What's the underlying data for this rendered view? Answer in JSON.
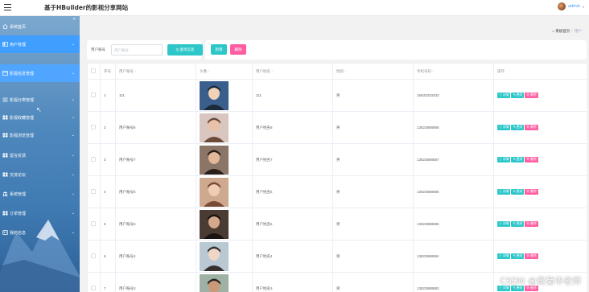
{
  "header": {
    "app_title": "基于HBuilder的影视分享网站",
    "user_name": "admin",
    "caret": "▾"
  },
  "sidebar": {
    "collapse_glyph": "«",
    "submenu_hint": "用户",
    "items": [
      {
        "label": "系统首页",
        "icon": "home-icon",
        "arrow": ""
      },
      {
        "label": "用户管理",
        "icon": "user-group-icon",
        "arrow": "⌄"
      },
      {
        "label": "影视信息管理",
        "icon": "film-icon",
        "arrow": "⌄"
      },
      {
        "label": "影视分类管理",
        "icon": "list-icon",
        "arrow": "⌄"
      },
      {
        "label": "影视收藏管理",
        "icon": "grid-icon",
        "arrow": "⌄"
      },
      {
        "label": "影视浏览管理",
        "icon": "grid-icon",
        "arrow": "⌄"
      },
      {
        "label": "留言反馈",
        "icon": "grid-icon",
        "arrow": "⌄"
      },
      {
        "label": "交流论坛",
        "icon": "grid-icon",
        "arrow": "⌄"
      },
      {
        "label": "系统管理",
        "icon": "bank-icon",
        "arrow": "⌄"
      },
      {
        "label": "订单管理",
        "icon": "grid-icon",
        "arrow": "⌄"
      },
      {
        "label": "我的信息",
        "icon": "id-card-icon",
        "arrow": "⌄"
      }
    ]
  },
  "breadcrumb": {
    "home": "系统首页",
    "separator": "/",
    "current": "用户"
  },
  "search": {
    "label": "用户账号",
    "placeholder": "用户账号",
    "button": "查询信息",
    "search_glyph": "Q"
  },
  "actions": {
    "add": "新增",
    "delete": "删除"
  },
  "table": {
    "headers": [
      "",
      "序号",
      "用户账号",
      "头像",
      "用户姓名",
      "性别",
      "手机号码",
      "操作"
    ],
    "sort_glyph": "↕",
    "op_labels": {
      "detail": "详情",
      "edit": "更改",
      "delete": "删除"
    },
    "rows": [
      {
        "index": "1",
        "account": "111",
        "name": "111",
        "gender": "男",
        "phone": "15633333333"
      },
      {
        "index": "2",
        "account": "用户账号8",
        "name": "用户姓名8",
        "gender": "男",
        "phone": "13823888888"
      },
      {
        "index": "3",
        "account": "用户账号7",
        "name": "用户姓名7",
        "gender": "男",
        "phone": "13823888887"
      },
      {
        "index": "4",
        "account": "用户账号6",
        "name": "用户姓名6",
        "gender": "男",
        "phone": "13823888886"
      },
      {
        "index": "5",
        "account": "用户账号5",
        "name": "用户姓名5",
        "gender": "男",
        "phone": "13823888885"
      },
      {
        "index": "6",
        "account": "用户账号4",
        "name": "用户姓名4",
        "gender": "男",
        "phone": "13823888884"
      },
      {
        "index": "7",
        "account": "用户账号3",
        "name": "用户姓名3",
        "gender": "男",
        "phone": "13823888883"
      }
    ]
  },
  "watermark": "CSDN @黄菊华老师",
  "colors": {
    "accent": "#409eff",
    "teal": "#2ec7c9",
    "pink": "#ff5fa2",
    "sidebar_top": "#7ca8cf",
    "sidebar_bottom": "#2c5f96"
  }
}
